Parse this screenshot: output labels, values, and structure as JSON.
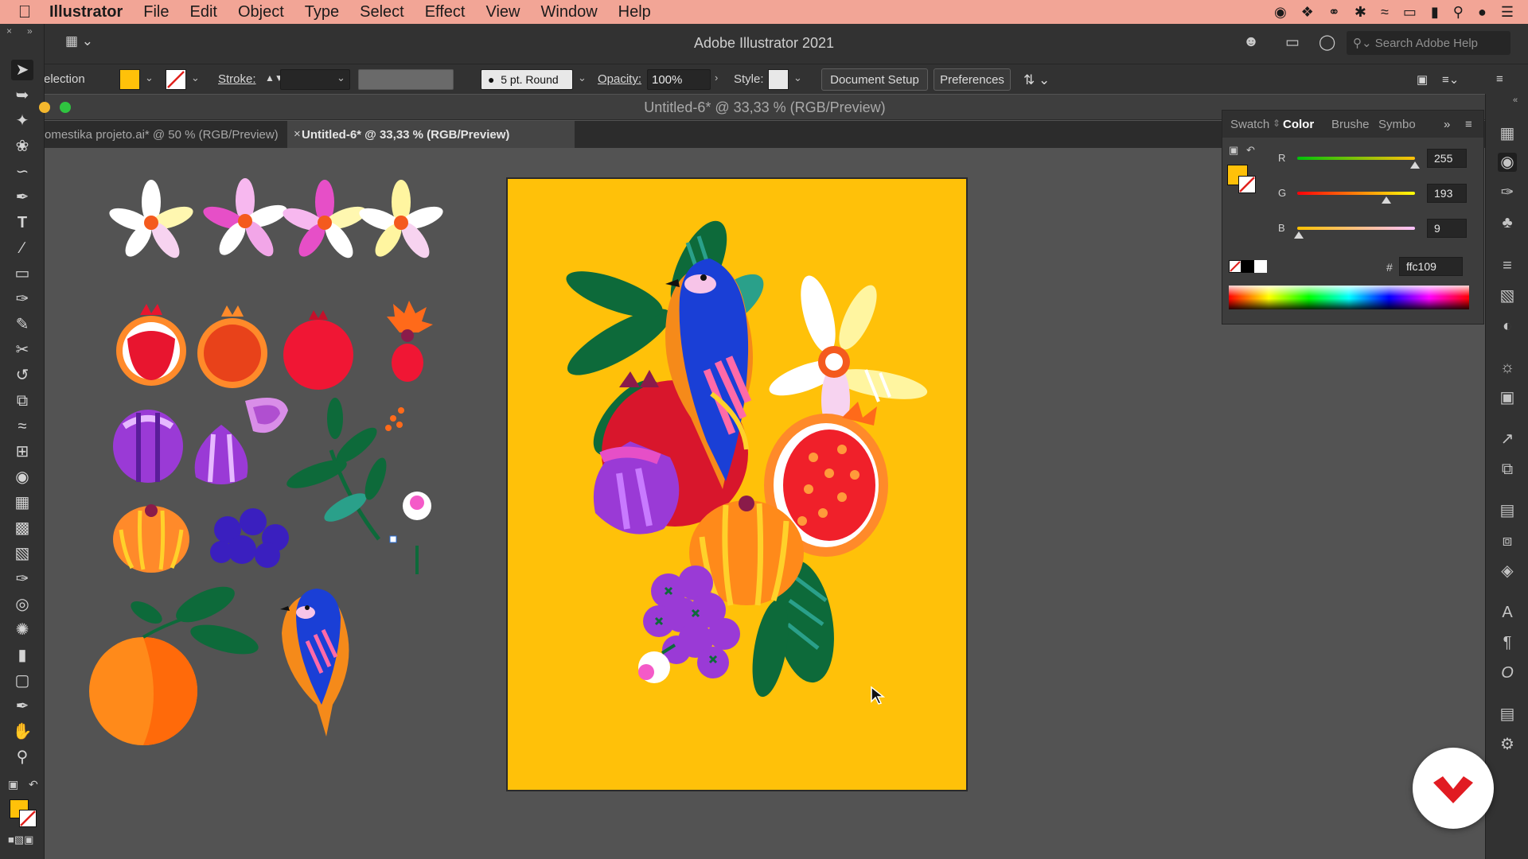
{
  "menubar": {
    "app": "Illustrator",
    "items": [
      "File",
      "Edit",
      "Object",
      "Type",
      "Select",
      "Effect",
      "View",
      "Window",
      "Help"
    ]
  },
  "appbar": {
    "title": "Adobe Illustrator 2021",
    "search_placeholder": "Search Adobe Help"
  },
  "control": {
    "selection_label": "election",
    "fill_color": "#ffc109",
    "stroke_label": "Stroke:",
    "brush": "5 pt. Round",
    "opacity_label": "Opacity:",
    "opacity_value": "100%",
    "style_label": "Style:",
    "document_setup": "Document Setup",
    "preferences": "Preferences"
  },
  "document": {
    "window_title": "Untitled-6* @ 33,33 % (RGB/Preview)",
    "tabs": [
      {
        "label": "omestika projeto.ai* @ 50 % (RGB/Preview)"
      },
      {
        "label": "Untitled-6* @ 33,33 % (RGB/Preview)"
      }
    ],
    "artboard_color": "#ffc109"
  },
  "color_panel": {
    "tabs": [
      "Swatch",
      "Color",
      "Brushe",
      "Symbo"
    ],
    "active_tab": "Color",
    "channels": [
      {
        "label": "R",
        "value": "255"
      },
      {
        "label": "G",
        "value": "193"
      },
      {
        "label": "B",
        "value": "9"
      }
    ],
    "hex_label": "#",
    "hex_value": "ffc109"
  },
  "toolbar": {
    "tools": [
      "selection-tool",
      "direct-selection-tool",
      "magic-wand-tool",
      "lasso-tool",
      "pen-tool",
      "curvature-tool",
      "type-tool",
      "line-tool",
      "rectangle-tool",
      "paintbrush-tool",
      "pencil-tool",
      "scissors-tool",
      "rotate-tool",
      "scale-tool",
      "warp-tool",
      "free-transform-tool",
      "shape-builder-tool",
      "perspective-grid-tool",
      "mesh-tool",
      "gradient-tool",
      "eyedropper-tool",
      "blend-tool",
      "symbol-sprayer-tool",
      "column-graph-tool",
      "artboard-tool",
      "slice-tool",
      "hand-tool",
      "zoom-tool"
    ]
  }
}
